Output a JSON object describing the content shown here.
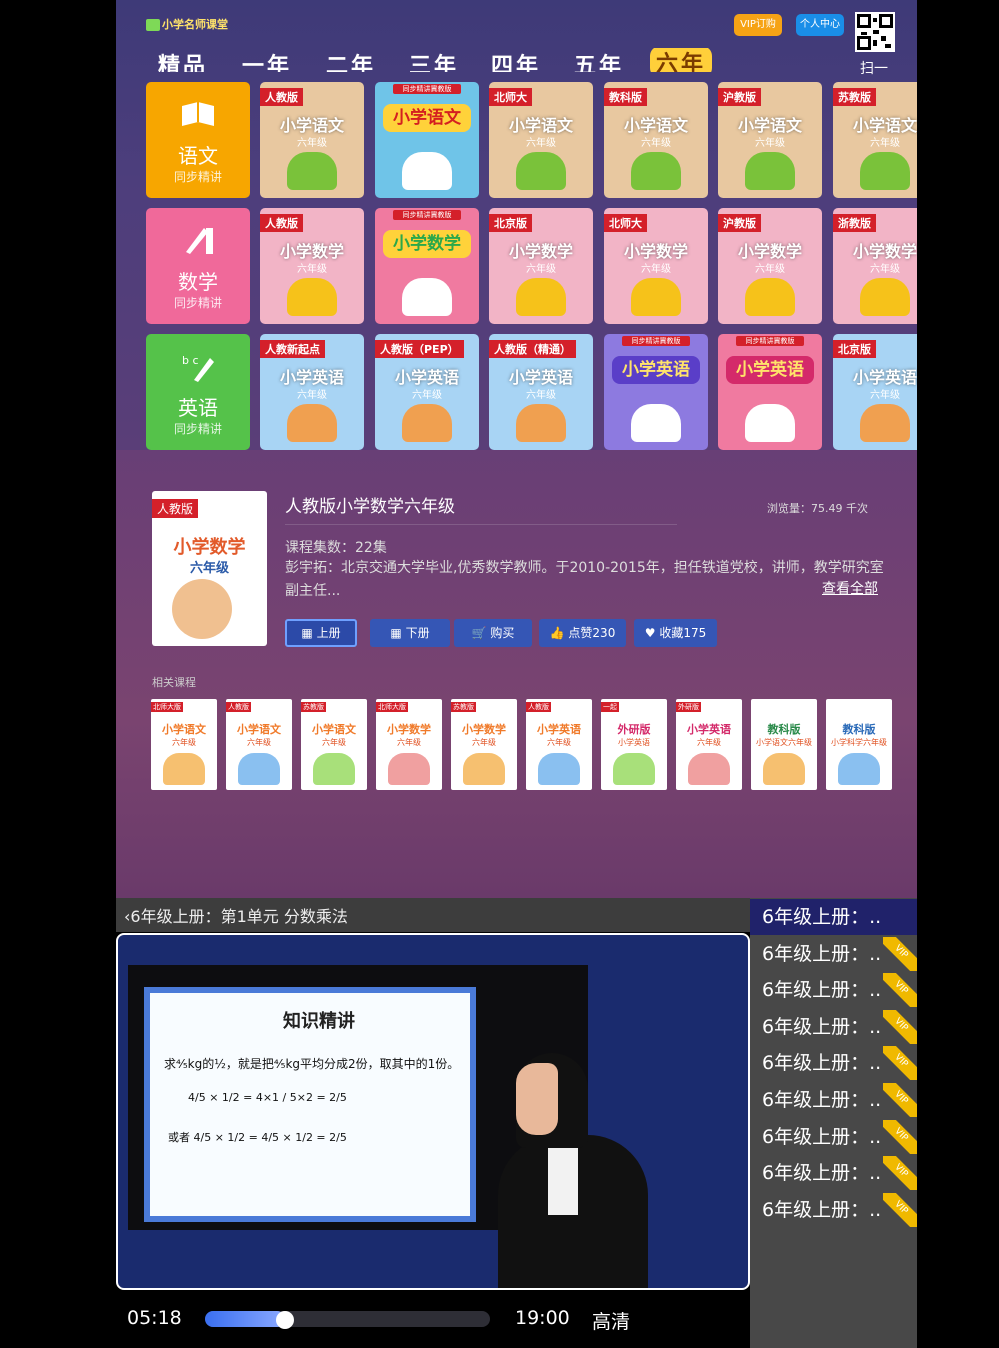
{
  "header": {
    "logo_text": "小学名师课堂",
    "vip_label": "VIP订购",
    "profile_label": "个人中心",
    "scan_label": "扫一"
  },
  "tabs": [
    "精品",
    "一年",
    "二年",
    "三年",
    "四年",
    "五年",
    "六年"
  ],
  "active_tab": "六年",
  "categories": [
    {
      "name": "语文",
      "sub": "同步精讲",
      "color": "#f7a600"
    },
    {
      "name": "数学",
      "sub": "同步精讲",
      "color": "#f0699a"
    },
    {
      "name": "英语",
      "sub": "同步精讲",
      "color": "#55c24a"
    }
  ],
  "rows": [
    [
      {
        "edition": "人教版",
        "title": "小学语文",
        "grade": "六年级",
        "bg": "#e8c8a0"
      },
      {
        "style": "special",
        "top": "同步精讲冀教版",
        "title": "小学语文",
        "bg": "#6fc4e8",
        "title_bg": "#ffd23a",
        "title_color": "#d42020"
      },
      {
        "edition": "北师大",
        "title": "小学语文",
        "grade": "六年级",
        "bg": "#e8c8a0"
      },
      {
        "edition": "教科版",
        "title": "小学语文",
        "grade": "六年级",
        "bg": "#e8c8a0"
      },
      {
        "edition": "沪教版",
        "title": "小学语文",
        "grade": "六年级",
        "bg": "#e8c8a0"
      },
      {
        "edition": "苏教版",
        "title": "小学语文",
        "grade": "六年级",
        "bg": "#e8c8a0"
      }
    ],
    [
      {
        "edition": "人教版",
        "title": "小学数学",
        "grade": "六年级",
        "bg": "#f2b4c6"
      },
      {
        "style": "special",
        "top": "同步精讲冀教版",
        "title": "小学数学",
        "bg": "#f07aa0",
        "title_bg": "#ffd23a",
        "title_color": "#2aa84a"
      },
      {
        "edition": "北京版",
        "title": "小学数学",
        "grade": "六年级",
        "bg": "#f2b4c6"
      },
      {
        "edition": "北师大",
        "title": "小学数学",
        "grade": "六年级",
        "bg": "#f2b4c6"
      },
      {
        "edition": "沪教版",
        "title": "小学数学",
        "grade": "六年级",
        "bg": "#f2b4c6"
      },
      {
        "edition": "浙教版",
        "title": "小学数学",
        "grade": "六年级",
        "bg": "#f2b4c6"
      }
    ],
    [
      {
        "edition": "人教新起点",
        "title": "小学英语",
        "grade": "六年级",
        "bg": "#a8d4f4"
      },
      {
        "edition": "人教版（PEP）",
        "title": "小学英语",
        "grade": "六年级",
        "bg": "#a8d4f4"
      },
      {
        "edition": "人教版（精通）",
        "title": "小学英语",
        "grade": "六年级",
        "bg": "#a8d4f4"
      },
      {
        "style": "special",
        "top": "同步精讲冀教版",
        "title": "小学英语",
        "bg": "#8d7ae0",
        "title_bg": "#5a3ec8",
        "title_color": "#ffe36a"
      },
      {
        "style": "special",
        "top": "同步精讲冀教版",
        "title": "小学英语",
        "bg": "#f07aa0",
        "title_bg": "#d42a6a",
        "title_color": "#ffe36a"
      },
      {
        "edition": "北京版",
        "title": "小学英语",
        "grade": "六年级",
        "bg": "#a8d4f4"
      }
    ]
  ],
  "detail": {
    "cover_edition": "人教版",
    "cover_title": "小学数学",
    "cover_grade": "六年级",
    "title": "人教版小学数学六年级",
    "views": "浏览量：75.49 千次",
    "episodes": "课程集数：22集",
    "description": "彭宇拓：北京交通大学毕业,优秀数学教师。于2010-2015年，担任铁道党校，讲师，教学研究室副主任...",
    "more": "查看全部",
    "actions": [
      "上册",
      "下册",
      "购买",
      "点赞230",
      "收藏175"
    ],
    "action_icons": [
      "grid-icon",
      "grid-icon",
      "cart-icon",
      "thumbs-up-icon",
      "heart-icon"
    ]
  },
  "related": {
    "label": "相关课程",
    "items": [
      {
        "edition": "北师大版",
        "title": "小学语文",
        "grade": "六年级",
        "color": "#f07a2a"
      },
      {
        "edition": "人教版",
        "title": "小学语文",
        "grade": "六年级",
        "color": "#f07a2a"
      },
      {
        "edition": "苏教版",
        "title": "小学语文",
        "grade": "六年级",
        "color": "#f07a2a"
      },
      {
        "edition": "北师大版",
        "title": "小学数学",
        "grade": "六年级",
        "color": "#f07a2a"
      },
      {
        "edition": "苏教版",
        "title": "小学数学",
        "grade": "六年级",
        "color": "#f07a2a"
      },
      {
        "edition": "人教版",
        "title": "小学英语",
        "grade": "六年级",
        "color": "#f07a2a"
      },
      {
        "edition": "一起",
        "title": "外研版",
        "grade": "小学英语",
        "color": "#d42a6a"
      },
      {
        "edition": "外研版",
        "title": "小学英语",
        "grade": "六年级",
        "color": "#d42a6a"
      },
      {
        "edition": "",
        "title": "教科版",
        "grade": "小学语文六年级",
        "color": "#2a8a4a"
      },
      {
        "edition": "",
        "title": "教科版",
        "grade": "小学科学六年级",
        "color": "#2a6ab8"
      }
    ]
  },
  "player": {
    "title": "6年级上册：第1单元 分数乘法",
    "board_heading": "知识精讲",
    "eq1": "求⁴⁄₅kg的½，就是把⁴⁄₅kg平均分成2份，取其中的1份。",
    "eq2": "4/5 × 1/2 = 4×1 / 5×2 = 2/5",
    "eq3": "或者 4/5 × 1/2 = 4/5 × 1/2 = 2/5",
    "current_time": "05:18",
    "total_time": "19:00",
    "progress": 0.28,
    "quality": "高清"
  },
  "episodes": {
    "items": [
      {
        "label": "6年级上册：..",
        "vip": false
      },
      {
        "label": "6年级上册：..",
        "vip": true
      },
      {
        "label": "6年级上册：..",
        "vip": true
      },
      {
        "label": "6年级上册：..",
        "vip": true
      },
      {
        "label": "6年级上册：..",
        "vip": true
      },
      {
        "label": "6年级上册：..",
        "vip": true
      },
      {
        "label": "6年级上册：..",
        "vip": true
      },
      {
        "label": "6年级上册：..",
        "vip": true
      },
      {
        "label": "6年级上册：..",
        "vip": true
      }
    ],
    "vip_tag": "VIP"
  }
}
